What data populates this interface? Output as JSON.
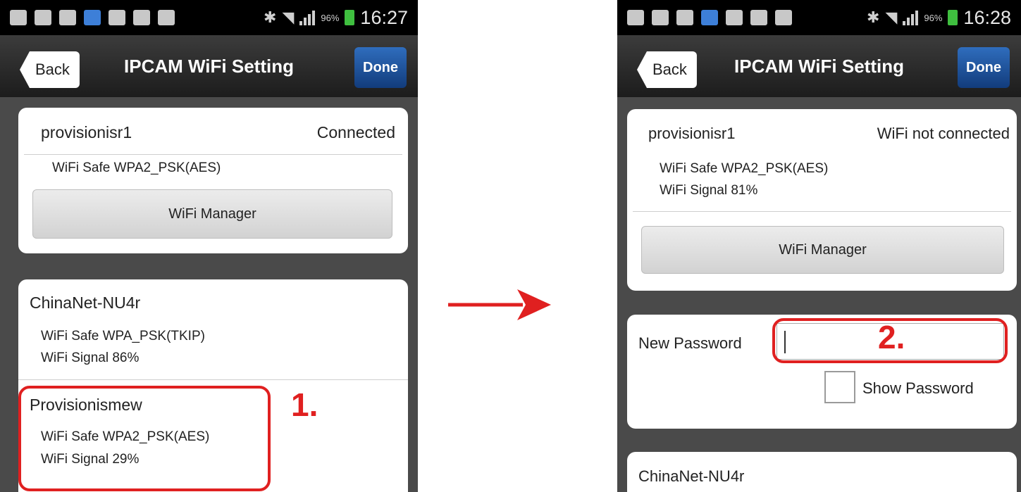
{
  "left": {
    "status": {
      "battery_pct": "96%",
      "time": "16:27"
    },
    "nav": {
      "back": "Back",
      "title": "IPCAM  WiFi Setting",
      "done": "Done"
    },
    "current": {
      "ssid": "provisionisr1",
      "status": "Connected",
      "safe": "WiFi Safe   WPA2_PSK(AES)",
      "manager": "WiFi Manager"
    },
    "networks": [
      {
        "ssid": "ChinaNet-NU4r",
        "safe": "WiFi Safe   WPA_PSK(TKIP)",
        "signal": "WiFi Signal   86%"
      },
      {
        "ssid": "Provisionismew",
        "safe": "WiFi Safe   WPA2_PSK(AES)",
        "signal": "WiFi Signal   29%"
      }
    ],
    "step": "1."
  },
  "right": {
    "status": {
      "battery_pct": "96%",
      "time": "16:28"
    },
    "nav": {
      "back": "Back",
      "title": "IPCAM  WiFi Setting",
      "done": "Done"
    },
    "current": {
      "ssid": "provisionisr1",
      "status": "WiFi not connected",
      "safe": "WiFi Safe   WPA2_PSK(AES)",
      "signal": "WiFi Signal   81%",
      "manager": "WiFi Manager"
    },
    "password": {
      "label": "New Password",
      "value": "",
      "show_label": "Show Password",
      "show_checked": false
    },
    "next_network": {
      "ssid": "ChinaNet-NU4r"
    },
    "step": "2."
  },
  "colors": {
    "annotation": "#e02020",
    "done_button": "#1f4f99",
    "arrow": "#e02020"
  }
}
